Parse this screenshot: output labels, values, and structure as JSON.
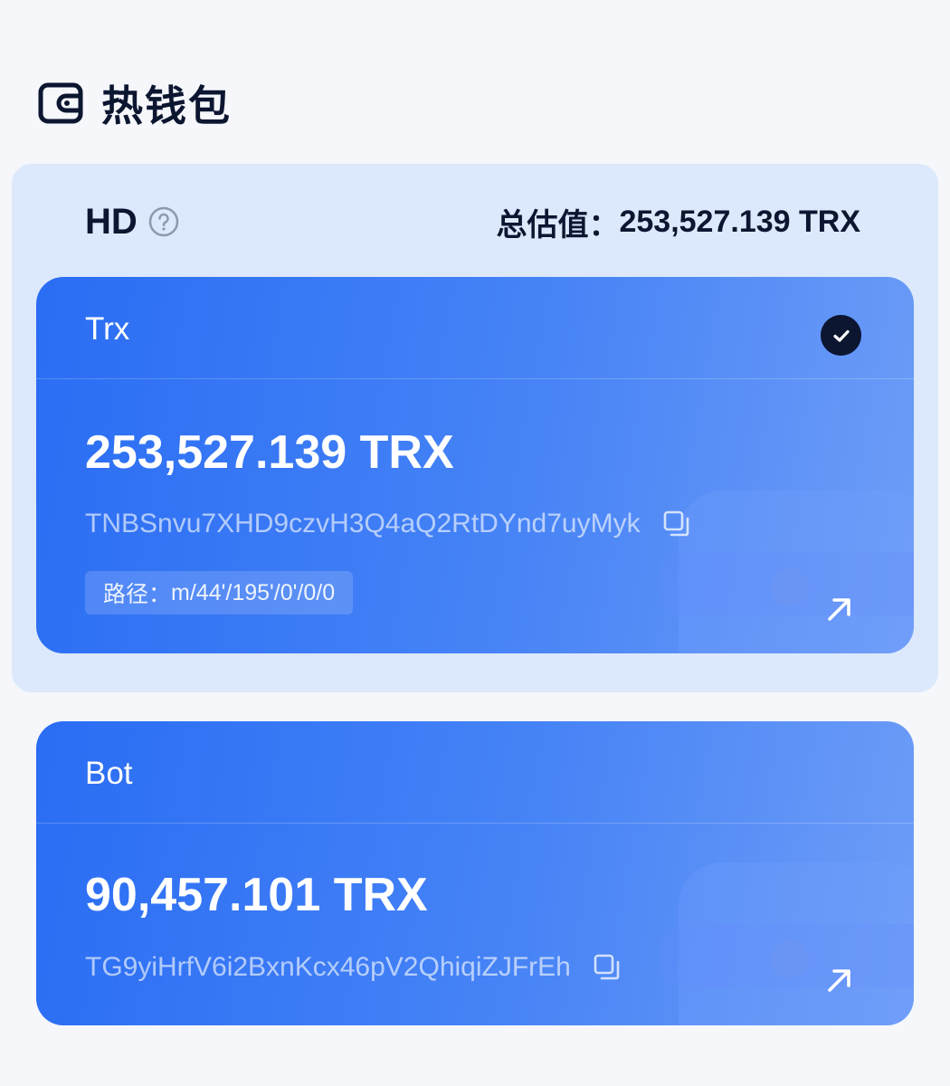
{
  "header": {
    "title": "热钱包",
    "icon": "wallet-icon"
  },
  "hd_group": {
    "label": "HD",
    "help_icon": "question-circle-icon",
    "total_label": "总估值：",
    "total_value": "253,527.139 TRX"
  },
  "accounts": [
    {
      "name": "Trx",
      "selected": true,
      "balance": "253,527.139 TRX",
      "address": "TNBSnvu7XHD9czvH3Q4aQ2RtDYnd7uyMyk",
      "path_label": "路径：",
      "path": "m/44'/195'/0'/0/0"
    },
    {
      "name": "Bot",
      "selected": false,
      "balance": "90,457.101 TRX",
      "address": "TG9yiHrfV6i2BxnKcx46pV2QhiqiZJFrEh"
    }
  ],
  "colors": {
    "background": "#f5f7fb",
    "group_background": "#dce8fb",
    "card_gradient_start": "#2a6df4",
    "card_gradient_end": "#6e9df7",
    "dark_text": "#0c1630"
  }
}
